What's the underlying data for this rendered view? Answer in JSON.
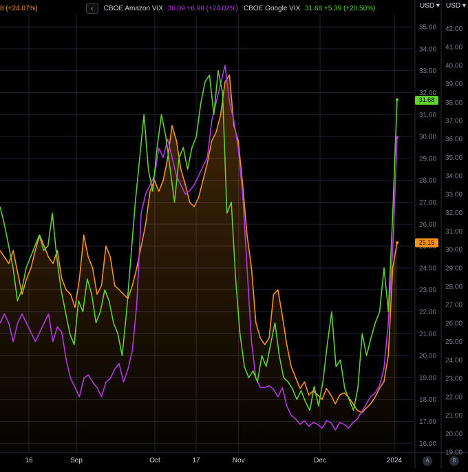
{
  "legend": [
    {
      "label": "8 (+24.07%)",
      "cls": "orange"
    },
    {
      "label": "CBOE Amazon VIX",
      "cls": "sym",
      "value": "36.09 +6.99 (+24.02%)",
      "vcls": "purple"
    },
    {
      "label": "CBOE Google VIX",
      "cls": "sym",
      "value": "31.68 +5.39 (+20.50%)",
      "vcls": "green"
    }
  ],
  "axis_units": {
    "left": "USD",
    "right": "USD"
  },
  "axis_buttons": {
    "a": "A",
    "b": "B"
  },
  "badges": {
    "green": "31.68",
    "orange": "25.15"
  },
  "colors": {
    "orange": "#f7931a",
    "purple": "#b636e9",
    "green": "#5fd12e",
    "grid": "#1e222d"
  },
  "chart_data": {
    "type": "line",
    "x_labels": [
      "16",
      "Sep",
      "Oct",
      "17",
      "Nov",
      "Dec",
      "2024"
    ],
    "left_axis": {
      "ticks": [
        "35.00",
        "34.00",
        "33.00",
        "32.00",
        "31.00",
        "30.00",
        "29.00",
        "28.00",
        "27.00",
        "26.00",
        "25.00",
        "24.00",
        "23.00",
        "22.00",
        "21.00",
        "20.00",
        "19.00",
        "18.00",
        "17.00",
        "16.00"
      ],
      "range": [
        15.6,
        35.6
      ]
    },
    "right_axis": {
      "ticks": [
        "42.00",
        "41.00",
        "40.00",
        "39.00",
        "38.00",
        "37.00",
        "36.00",
        "35.00",
        "34.00",
        "33.00",
        "32.00",
        "31.00",
        "30.00",
        "29.00",
        "28.00",
        "27.00",
        "26.00",
        "25.00",
        "24.00",
        "23.00",
        "22.00",
        "21.00",
        "20.00",
        "19.00"
      ],
      "range": [
        19.0,
        42.8
      ]
    },
    "series": [
      {
        "name": "",
        "color": "#f7931a",
        "axis": "left",
        "fill": true,
        "values": [
          24.8,
          24.5,
          24.2,
          24.8,
          23.8,
          22.8,
          23.5,
          24.0,
          24.8,
          25.5,
          25.0,
          24.5,
          24.2,
          24.8,
          23.5,
          23.0,
          22.8,
          22.2,
          23.5,
          25.5,
          24.5,
          24.0,
          22.8,
          23.2,
          25.0,
          24.5,
          23.2,
          23.0,
          22.8,
          22.6,
          23.2,
          24.0,
          25.0,
          26.0,
          27.5,
          28.0,
          27.5,
          28.0,
          29.0,
          30.5,
          29.8,
          28.5,
          27.8,
          27.0,
          26.8,
          27.2,
          28.0,
          28.8,
          29.8,
          30.2,
          31.0,
          32.5,
          32.8,
          30.5,
          29.8,
          27.8,
          25.5,
          24.0,
          21.5,
          20.8,
          20.5,
          20.8,
          22.8,
          23.0,
          21.8,
          20.5,
          19.5,
          19.0,
          18.5,
          18.8,
          18.2,
          18.4,
          18.2,
          18.0,
          18.5,
          18.2,
          17.8,
          18.2,
          18.3,
          18.1,
          17.8,
          17.5,
          17.4,
          17.6,
          17.8,
          18.1,
          18.5,
          18.8,
          20.0,
          24.0,
          25.15
        ]
      },
      {
        "name": "CBOE Amazon VIX",
        "color": "#b636e9",
        "axis": "right",
        "values": [
          26.0,
          26.5,
          26.0,
          25.0,
          26.0,
          26.5,
          26.0,
          25.5,
          25.0,
          25.5,
          26.0,
          26.5,
          25.0,
          25.8,
          25.5,
          24.0,
          23.0,
          22.5,
          22.0,
          23.0,
          23.2,
          22.8,
          22.5,
          22.0,
          22.8,
          23.0,
          23.5,
          23.8,
          22.8,
          23.5,
          24.5,
          27.0,
          32.0,
          33.0,
          33.5,
          34.0,
          35.5,
          35.0,
          36.0,
          35.0,
          34.0,
          33.5,
          33.0,
          33.2,
          33.5,
          34.0,
          34.5,
          35.0,
          37.0,
          38.0,
          39.0,
          40.0,
          38.0,
          37.0,
          35.5,
          33.0,
          29.0,
          25.0,
          23.0,
          22.5,
          22.5,
          22.6,
          22.4,
          22.0,
          22.5,
          21.5,
          21.0,
          20.8,
          20.5,
          20.7,
          20.4,
          20.6,
          20.5,
          20.3,
          20.7,
          20.6,
          20.2,
          20.6,
          20.5,
          20.3,
          20.6,
          20.8,
          21.2,
          21.6,
          22.0,
          22.2,
          22.6,
          23.5,
          26.0,
          30.0,
          36.09
        ]
      },
      {
        "name": "CBOE Google VIX",
        "color": "#5fd12e",
        "axis": "left",
        "values": [
          26.8,
          26.0,
          25.0,
          24.0,
          22.5,
          23.0,
          24.0,
          24.5,
          25.0,
          25.5,
          24.8,
          25.0,
          26.5,
          24.5,
          23.0,
          22.0,
          21.0,
          20.5,
          22.5,
          22.0,
          23.5,
          22.8,
          21.5,
          22.0,
          23.0,
          22.5,
          21.5,
          21.0,
          20.0,
          22.0,
          24.5,
          27.0,
          29.0,
          31.0,
          28.5,
          27.5,
          29.5,
          31.0,
          30.0,
          28.5,
          27.0,
          29.0,
          29.5,
          28.5,
          29.5,
          30.0,
          31.5,
          32.5,
          32.8,
          31.0,
          33.0,
          32.0,
          26.5,
          27.0,
          23.5,
          21.0,
          19.5,
          19.0,
          19.3,
          18.8,
          20.0,
          19.5,
          20.5,
          21.5,
          20.0,
          19.0,
          18.8,
          18.5,
          18.0,
          18.4,
          17.9,
          17.5,
          18.6,
          17.7,
          18.8,
          20.5,
          22.0,
          19.5,
          19.8,
          18.5,
          18.0,
          17.5,
          18.5,
          21.0,
          20.0,
          20.8,
          21.5,
          22.0,
          24.0,
          22.0,
          26.5,
          31.68
        ]
      }
    ]
  }
}
